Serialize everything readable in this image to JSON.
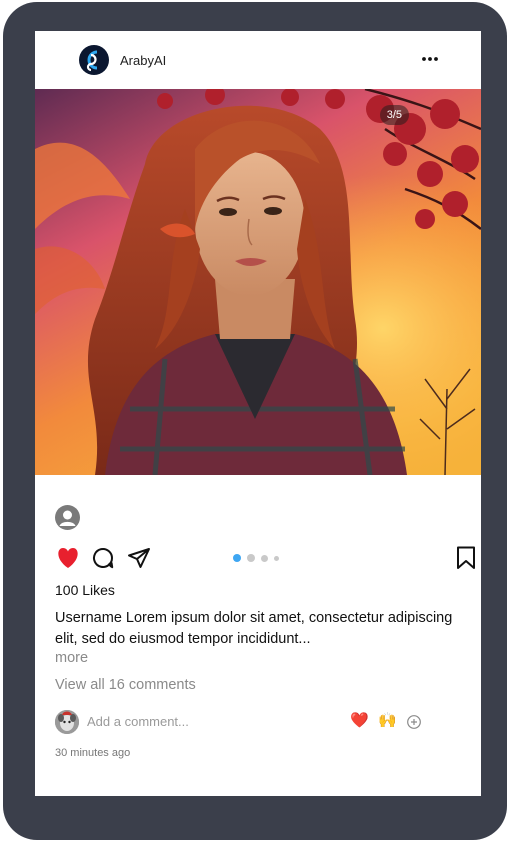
{
  "post": {
    "account_name": "ArabyAI",
    "image_counter": "3/5",
    "likes": "100 Likes",
    "caption": "Username Lorem ipsum dolor sit amet, consectetur adipiscing elit, sed do eiusmod tempor incididunt...",
    "more_label": "more",
    "view_comments": "View all 16 comments",
    "comment_placeholder": "Add a comment...",
    "quick_reactions": [
      "❤️",
      "🙌"
    ],
    "timestamp": "30 minutes ago",
    "carousel": {
      "current": 1,
      "total": 4
    },
    "liked": true
  },
  "icons": {
    "menu": "more-horizontal-icon",
    "like": "heart-icon",
    "comment": "comment-bubble-icon",
    "share": "paper-plane-icon",
    "save": "bookmark-icon",
    "add_reaction": "plus-circle-icon"
  },
  "colors": {
    "frame": "#3b3f4b",
    "like_red": "#e8202e",
    "active_dot": "#3ea6f2",
    "inactive_dot": "#c9c9c9"
  }
}
